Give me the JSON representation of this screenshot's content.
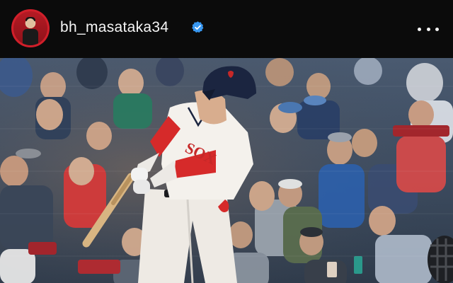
{
  "header": {
    "username": "bh_masataka34",
    "verified": true,
    "verified_icon": "verified-badge-icon",
    "more_icon": "more-options-icon"
  },
  "post": {
    "image_alt": "Baseball player in a white home uniform with red sleeves and a navy helmet swinging a bat in front of a crowd of fans",
    "jersey_text": "SOX",
    "colors": {
      "header_bg": "#0b0b0b",
      "avatar_ring": "#d11f2a",
      "verified_blue": "#3897f0",
      "uniform_red": "#d62a2a",
      "helmet_navy": "#1b2540"
    }
  }
}
